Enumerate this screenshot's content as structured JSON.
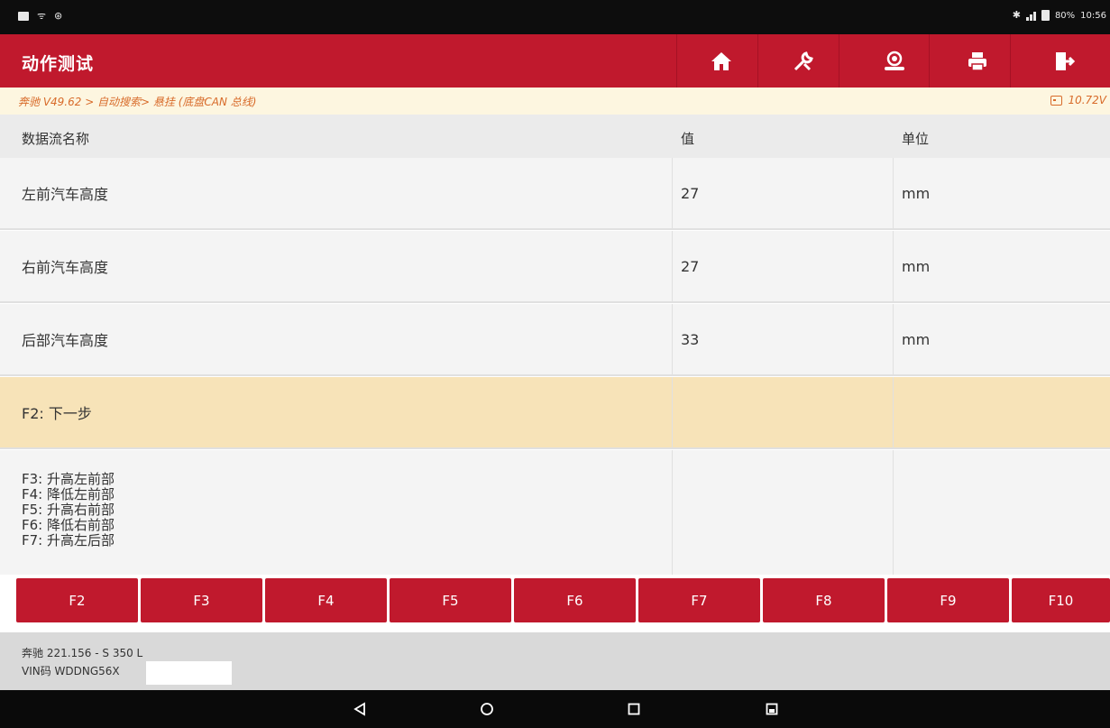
{
  "status_bar": {
    "icons": [
      "notification-icon",
      "wifi-icon",
      "settings-icon",
      "bluetooth-icon",
      "signal-icon",
      "battery-icon"
    ],
    "battery": "80%",
    "time": "10:56"
  },
  "header": {
    "title": "动作测试",
    "buttons": [
      "home-icon",
      "diagnostic-icon",
      "user-icon",
      "print-icon",
      "exit-icon"
    ]
  },
  "breadcrumb": {
    "path": "奔驰 V49.62 > 自动搜索> 悬挂 (底盘CAN 总线)",
    "voltage": "10.72V"
  },
  "table": {
    "headers": {
      "name": "数据流名称",
      "value": "值",
      "unit": "单位"
    },
    "rows": [
      {
        "name": "左前汽车高度",
        "value": "27",
        "unit": "mm"
      },
      {
        "name": "右前汽车高度",
        "value": "27",
        "unit": "mm"
      },
      {
        "name": "后部汽车高度",
        "value": "33",
        "unit": "mm"
      }
    ],
    "highlight_row": "F2: 下一步",
    "instructions": [
      "F3: 升高左前部",
      "F4: 降低左前部",
      "F5: 升高右前部",
      "F6: 降低右前部",
      "F7: 升高左后部"
    ]
  },
  "function_keys": [
    "F2",
    "F3",
    "F4",
    "F5",
    "F6",
    "F7",
    "F8",
    "F9",
    "F10"
  ],
  "footer": {
    "vehicle": "奔驰 221.156 - S 350 L",
    "vin": "VIN码 WDDNG56X"
  },
  "colors": {
    "accent": "#c0192d",
    "highlight": "#f7e3b8",
    "breadcrumb_text": "#d86b2a"
  }
}
